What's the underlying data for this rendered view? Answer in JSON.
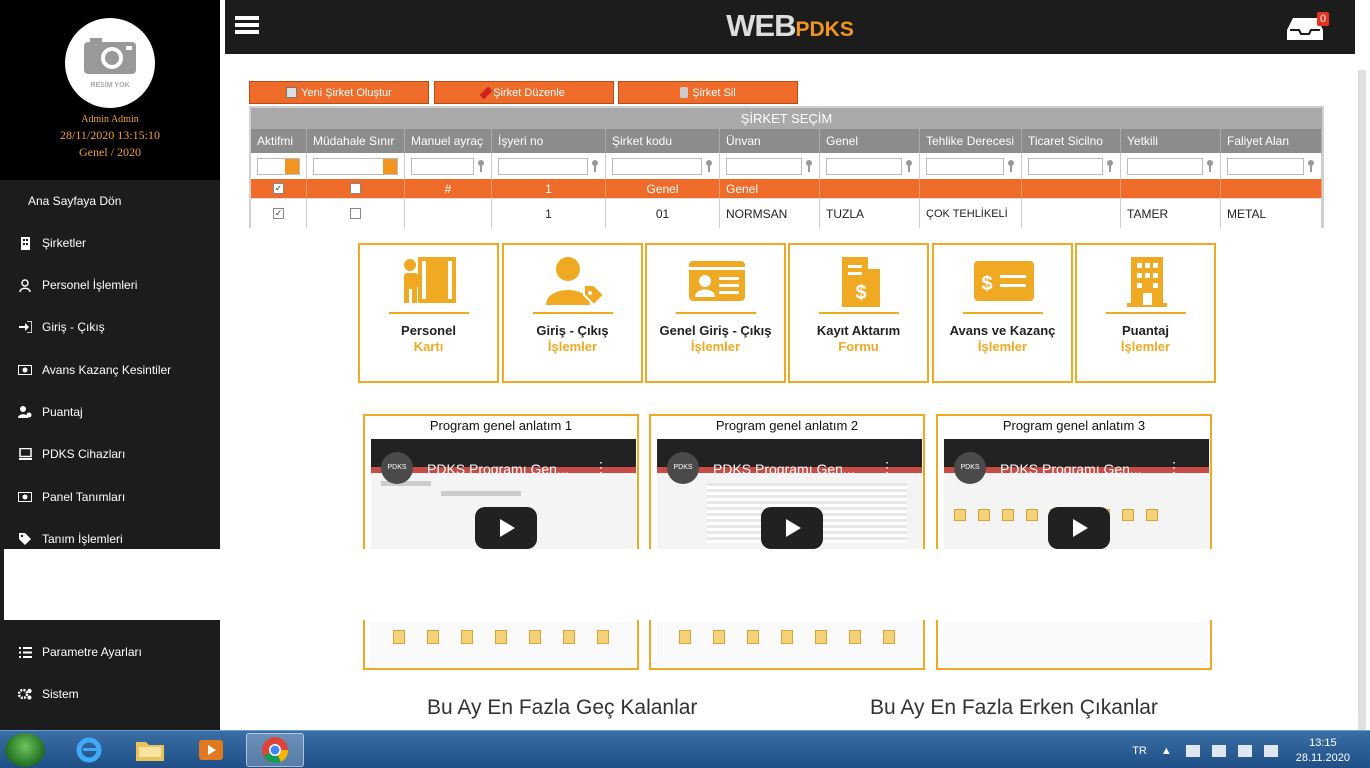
{
  "profile": {
    "avatar_text": "RESİM YOK",
    "name": "Admin Admin",
    "datetime": "28/11/2020 13:15:10",
    "period": "Genel / 2020"
  },
  "menu": [
    {
      "label": "Ana Sayfaya Dön",
      "icon": "none"
    },
    {
      "label": "Şirketler",
      "icon": "building-icon"
    },
    {
      "label": "Personel İşlemleri",
      "icon": "user-icon"
    },
    {
      "label": "Giriş - Çıkış",
      "icon": "sign-in-icon"
    },
    {
      "label": "Avans Kazanç Kesintiler",
      "icon": "money-icon"
    },
    {
      "label": "Puantaj",
      "icon": "users-gear-icon"
    },
    {
      "label": "PDKS Cihazları",
      "icon": "device-icon"
    },
    {
      "label": "Panel Tanımları",
      "icon": "money-icon"
    },
    {
      "label": "Tanım İşlemleri",
      "icon": "tag-icon"
    },
    {
      "label": "Parametre Ayarları",
      "icon": "list-icon"
    },
    {
      "label": "Sistem",
      "icon": "gears-icon"
    }
  ],
  "header": {
    "logo_web": "WEB",
    "logo_pdks": "PDKS",
    "notification_count": "0"
  },
  "toolbar": {
    "new_label": "Yeni Şirket Oluştur",
    "edit_label": "Şirket Düzenle",
    "delete_label": "Şirket Sil"
  },
  "table": {
    "title": "ŞİRKET SEÇİM",
    "columns": [
      "Aktifmi",
      "Müdahale Sınır",
      "Manuel ayraç",
      "İşyeri no",
      "Şirket kodu",
      "Ünvan",
      "Genel",
      "Tehlike Derecesi",
      "Ticaret Sicilno",
      "Yetkili",
      "Faliyet Alan"
    ],
    "highlight_row": [
      "",
      "",
      "#",
      "1",
      "Genel",
      "Genel",
      "",
      "",
      "",
      "",
      ""
    ],
    "data_row": [
      "",
      "",
      "",
      "1",
      "01",
      "NORMSAN",
      "TUZLA",
      "ÇOK TEHLİKELİ",
      "",
      "TAMER",
      "METAL"
    ]
  },
  "tiles": [
    {
      "line1": "Personel",
      "line2": "Kartı",
      "icon": "personnel-door-icon"
    },
    {
      "line1": "Giriş - Çıkış",
      "line2": "İşlemler",
      "icon": "user-tag-icon"
    },
    {
      "line1": "Genel Giriş - Çıkış",
      "line2": "İşlemler",
      "icon": "id-card-icon"
    },
    {
      "line1": "Kayıt Aktarım",
      "line2": "Formu",
      "icon": "invoice-dollar-icon"
    },
    {
      "line1": "Avans ve Kazanç",
      "line2": "İşlemler",
      "icon": "money-check-icon"
    },
    {
      "line1": "Puantaj",
      "line2": "İşlemler",
      "icon": "building-icon"
    }
  ],
  "videos": [
    {
      "heading": "Program genel anlatım 1",
      "title": "PDKS Programı Gen...",
      "logo": "PDKS"
    },
    {
      "heading": "Program genel anlatım 2",
      "title": "PDKS Programı Gen...",
      "logo": "PDKS"
    },
    {
      "heading": "Program genel anlatım 3",
      "title": "PDKS Programı Gen...",
      "logo": "PDKS"
    }
  ],
  "stats": {
    "late": "Bu Ay En Fazla Geç Kalanlar",
    "early": "Bu Ay En Fazla Erken Çıkanlar"
  },
  "taskbar": {
    "lang": "TR",
    "time": "13:15",
    "date": "28.11.2020"
  },
  "colors": {
    "accent": "#ef6b2a",
    "tile": "#f0a923",
    "dark": "#1c1c1c"
  }
}
